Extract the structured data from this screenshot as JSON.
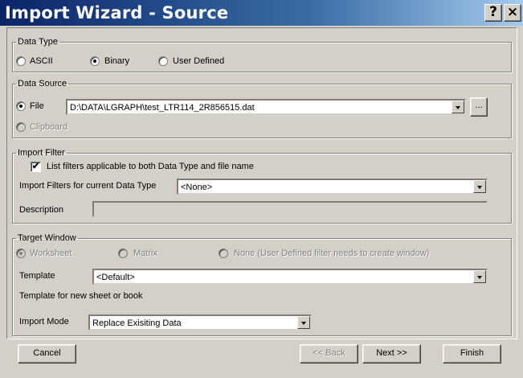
{
  "window": {
    "title": "Import Wizard - Source",
    "help_glyph": "?",
    "close_glyph": "×"
  },
  "data_type": {
    "legend": "Data Type",
    "options": [
      "ASCII",
      "Binary",
      "User Defined"
    ],
    "selected": "Binary"
  },
  "data_source": {
    "legend": "Data Source",
    "file_label": "File",
    "file_path": "D:\\DATA\\LGRAPH\\test_LTR114_2R856515.dat",
    "browse_label": "...",
    "clipboard_label": "Clipboard",
    "selected": "File"
  },
  "import_filter": {
    "legend": "Import Filter",
    "list_filters_label": "List filters applicable to both Data Type and file name",
    "list_filters_checked": true,
    "filters_label": "Import Filters for current Data Type",
    "filter_value": "<None>",
    "description_label": "Description",
    "description_value": ""
  },
  "target_window": {
    "legend": "Target Window",
    "options": [
      "Worksheet",
      "Matrix",
      "None (User Defined filter needs to create window)"
    ],
    "selected": "Worksheet",
    "template_label": "Template",
    "template_value": "<Default>",
    "template_note": "Template for new sheet or book",
    "import_mode_label": "Import Mode",
    "import_mode_value": "Replace Exisiting Data"
  },
  "buttons": {
    "cancel": "Cancel",
    "back": "<< Back",
    "next": "Next >>",
    "finish": "Finish"
  },
  "colors": {
    "title_gradient_start": "#0a246a",
    "title_gradient_end": "#a6caf0",
    "face": "#d4d0c8"
  }
}
